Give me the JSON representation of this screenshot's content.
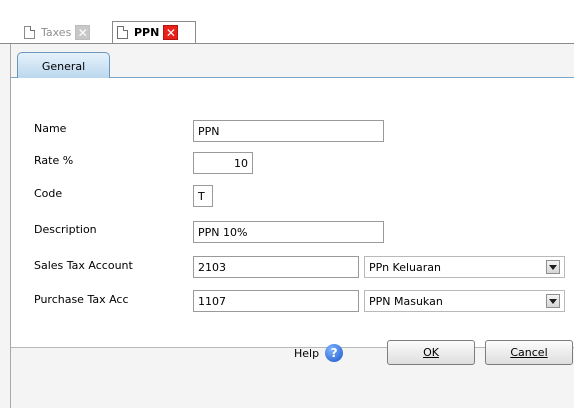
{
  "doc_tabs": [
    {
      "label": "Taxes",
      "active": false
    },
    {
      "label": "PPN",
      "active": true
    }
  ],
  "section_tab": {
    "label": "General"
  },
  "form": {
    "name": {
      "label": "Name",
      "value": "PPN"
    },
    "rate": {
      "label": "Rate %",
      "value": "10"
    },
    "code": {
      "label": "Code",
      "value": "T"
    },
    "description": {
      "label": "Description",
      "value": "PPN 10%"
    },
    "sales_tax_account": {
      "label": "Sales Tax Account",
      "value": "2103",
      "account_name": "PPn Keluaran"
    },
    "purchase_tax_acc": {
      "label": "Purchase Tax Acc",
      "value": "1107",
      "account_name": "PPN Masukan"
    }
  },
  "buttons": {
    "help": "Help",
    "ok": "OK",
    "cancel": "Cancel"
  },
  "icons": {
    "document": "document-icon",
    "close": "close-icon",
    "help": "help-icon",
    "dropdown": "chevron-down-icon"
  },
  "colors": {
    "close_active": "#e8211a",
    "close_inactive": "#c8c8c8",
    "tab_accent": "#b9d6ee",
    "help_icon": "#1b58c9"
  }
}
